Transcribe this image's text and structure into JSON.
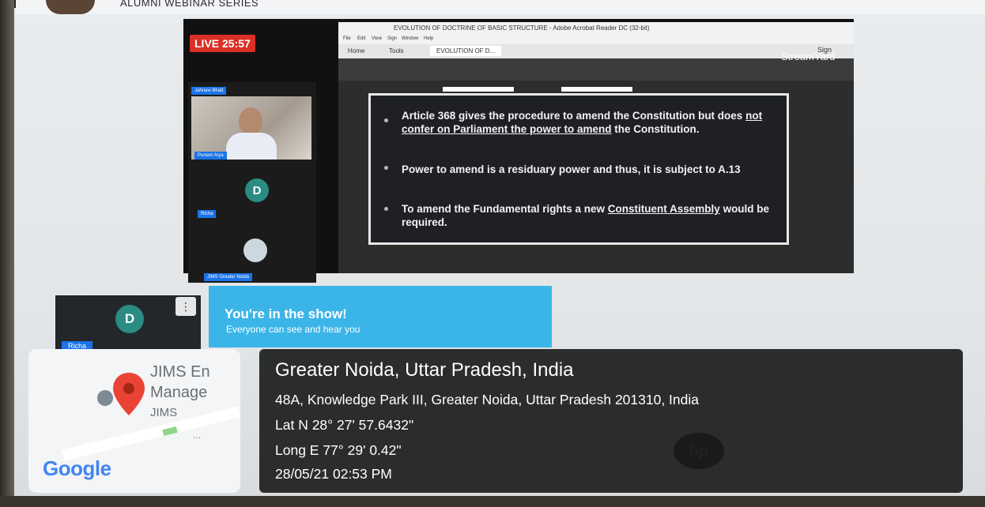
{
  "header": {
    "title": "ALUMNI WEBINAR SERIES"
  },
  "stream": {
    "live_badge": "LIVE 25:57",
    "brand": "StreamYard",
    "participants": [
      {
        "name": "Jahnavi Bhatt"
      },
      {
        "name": "Puneet Arya"
      },
      {
        "name": "Richa",
        "initial": "D"
      },
      {
        "name": "JIMS Greater Noida"
      }
    ]
  },
  "acrobat": {
    "window_title": "EVOLUTION OF DOCTRINE OF BASIC STRUCTURE - Adobe Acrobat Reader DC (32-bit)",
    "menu": [
      "File",
      "Edit",
      "View",
      "Sign",
      "Window",
      "Help"
    ],
    "tabs": [
      "Home",
      "Tools",
      "EVOLUTION OF D..."
    ],
    "sign_label": "Sign"
  },
  "slide": {
    "p1_a": "Article 368 gives the procedure to amend the Constitution but does ",
    "p1_u": "not confer on Parliament the power to amend",
    "p1_b": " the Constitution.",
    "p2": "Power to amend is a residuary power and thus, it is subject to A.13",
    "p3_a": "To amend the Fundamental rights a new ",
    "p3_u": "Constituent Assembly",
    "p3_b": " would be required."
  },
  "studio": {
    "self_initial": "D",
    "self_name": "Richa",
    "show_title": "You're in the show!",
    "show_sub": "Everyone can see and hear you"
  },
  "gps": {
    "map_label_1": "JIMS En",
    "map_label_2": "Manage",
    "map_label_3": "JIMS",
    "map_more": "...",
    "google": "Google",
    "place": "Greater Noida, Uttar Pradesh, India",
    "address": "48A, Knowledge Park III, Greater Noida, Uttar Pradesh 201310, India",
    "lat": "Lat N 28° 27' 57.6432\"",
    "long": "Long E 77° 29' 0.42\"",
    "datetime": "28/05/21 02:53 PM"
  },
  "colors": {
    "live": "#d93025",
    "show_banner": "#3bb5e8",
    "pin": "#ea4335"
  }
}
